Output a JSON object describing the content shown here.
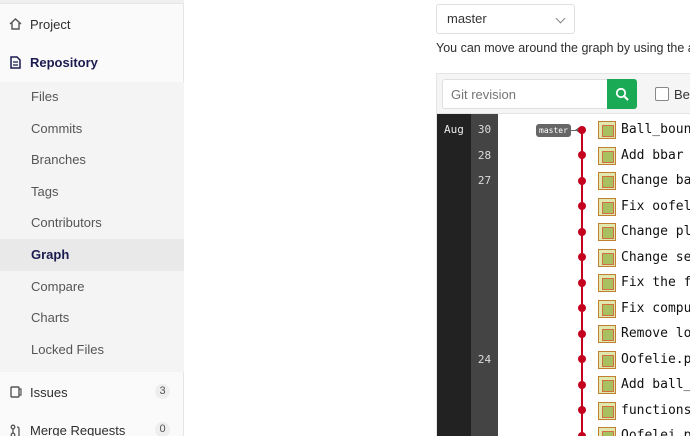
{
  "sidebar": {
    "project_label": "Project",
    "repository_label": "Repository",
    "sub_items": [
      {
        "label": "Files"
      },
      {
        "label": "Commits"
      },
      {
        "label": "Branches"
      },
      {
        "label": "Tags"
      },
      {
        "label": "Contributors"
      },
      {
        "label": "Graph"
      },
      {
        "label": "Compare"
      },
      {
        "label": "Charts"
      },
      {
        "label": "Locked Files"
      }
    ],
    "issues_label": "Issues",
    "issues_count": "3",
    "merge_requests_label": "Merge Requests",
    "merge_requests_count": "0",
    "active_item": "Graph"
  },
  "main": {
    "branch_selected": "master",
    "help_text": "You can move around the graph by using the arr",
    "revision_placeholder": "Git revision",
    "checkbox_label": "Beg",
    "accent_color": "#1aaa55",
    "graph_line_color": "#c5001f"
  },
  "graph": {
    "month": "Aug",
    "days": [
      {
        "label": "30"
      },
      {
        "label": "28"
      },
      {
        "label": "27"
      },
      {
        "label": "24"
      }
    ],
    "branch_tag": "master",
    "commits": [
      {
        "message": "Ball_boun"
      },
      {
        "message": "Add bbar "
      },
      {
        "message": "Change ba"
      },
      {
        "message": "Fix oofel"
      },
      {
        "message": "Change pl"
      },
      {
        "message": "Change se"
      },
      {
        "message": "Fix the f"
      },
      {
        "message": "Fix compu"
      },
      {
        "message": "Remove lo"
      },
      {
        "message": "Oofelie.p"
      },
      {
        "message": "Add ball_"
      },
      {
        "message": "functions"
      },
      {
        "message": "Oofelei.p"
      }
    ]
  }
}
